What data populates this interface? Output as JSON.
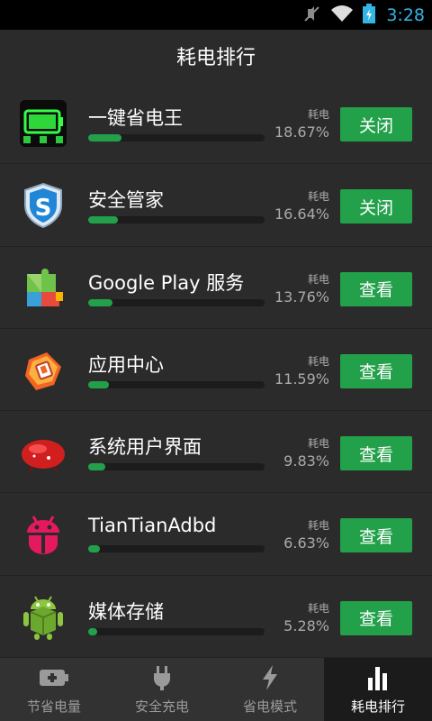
{
  "status_bar": {
    "time": "3:28"
  },
  "header": {
    "title": "耗电排行"
  },
  "rows": [
    {
      "name": "一键省电王",
      "label": "耗电",
      "percent": "18.67%",
      "button": "关闭",
      "usage": 0.1867,
      "icon": "battery-icon"
    },
    {
      "name": "安全管家",
      "label": "耗电",
      "percent": "16.64%",
      "button": "关闭",
      "usage": 0.1664,
      "icon": "shield-s-icon"
    },
    {
      "name": "Google Play 服务",
      "label": "耗电",
      "percent": "13.76%",
      "button": "查看",
      "usage": 0.1376,
      "icon": "puzzle-icon"
    },
    {
      "name": "应用中心",
      "label": "耗电",
      "percent": "11.59%",
      "button": "查看",
      "usage": 0.1159,
      "icon": "app-center-icon"
    },
    {
      "name": "系统用户界面",
      "label": "耗电",
      "percent": "9.83%",
      "button": "查看",
      "usage": 0.0983,
      "icon": "jellybean-icon"
    },
    {
      "name": "TianTianAdbd",
      "label": "耗电",
      "percent": "6.63%",
      "button": "查看",
      "usage": 0.0663,
      "icon": "android-red-icon"
    },
    {
      "name": "媒体存储",
      "label": "耗电",
      "percent": "5.28%",
      "button": "查看",
      "usage": 0.0528,
      "icon": "android-box-icon"
    }
  ],
  "tabs": [
    {
      "label": "节省电量",
      "icon": "battery-plus-icon",
      "active": false
    },
    {
      "label": "安全充电",
      "icon": "plug-icon",
      "active": false
    },
    {
      "label": "省电模式",
      "icon": "lightning-icon",
      "active": false
    },
    {
      "label": "耗电排行",
      "icon": "bar-chart-icon",
      "active": true
    }
  ],
  "colors": {
    "accent": "#22a14a",
    "status_time": "#33b5e5"
  }
}
